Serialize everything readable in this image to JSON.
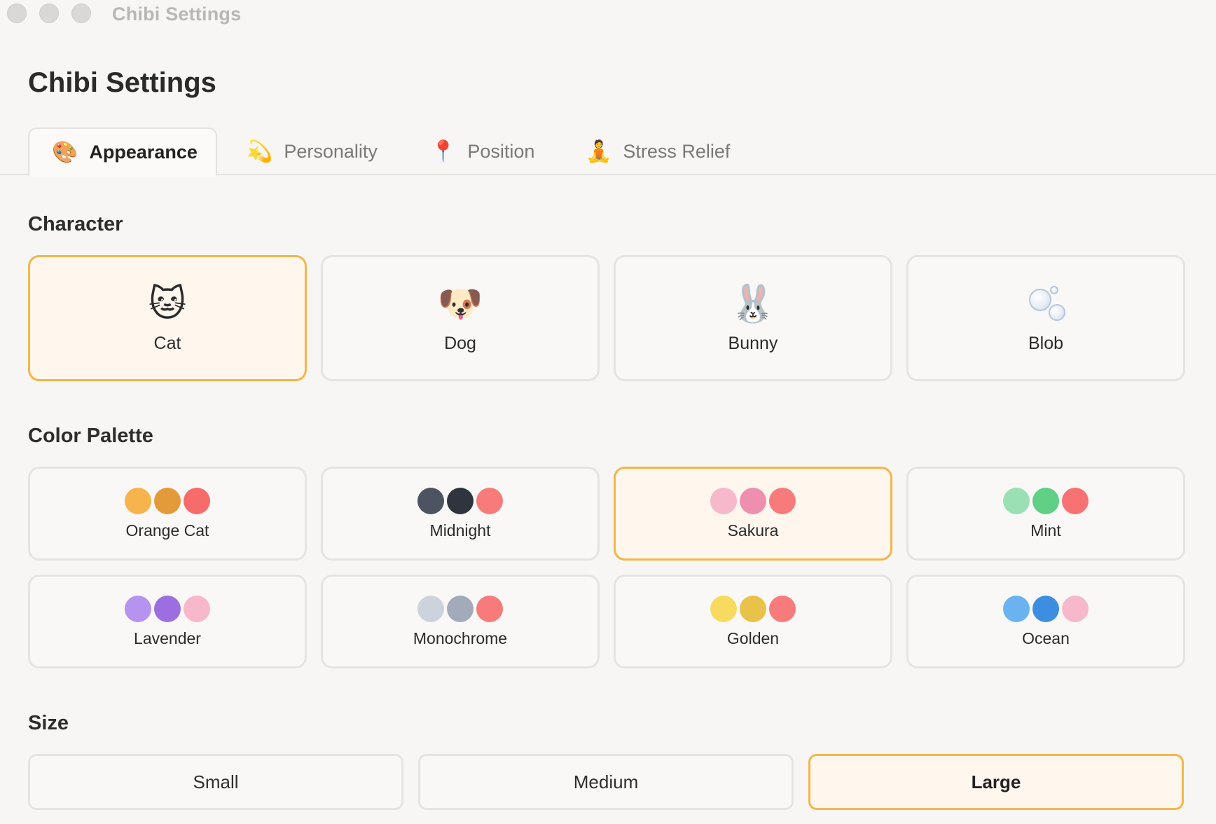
{
  "window": {
    "title": "Chibi Settings"
  },
  "page": {
    "title": "Chibi Settings"
  },
  "tabs": [
    {
      "label": "Appearance",
      "icon": "palette-icon",
      "active": true
    },
    {
      "label": "Personality",
      "icon": "comet-icon",
      "active": false
    },
    {
      "label": "Position",
      "icon": "pin-icon",
      "active": false
    },
    {
      "label": "Stress Relief",
      "icon": "meditation-icon",
      "active": false
    }
  ],
  "character": {
    "title": "Character",
    "options": [
      {
        "label": "Cat",
        "emoji": "🐱",
        "icon": "cat-icon",
        "selected": true
      },
      {
        "label": "Dog",
        "emoji": "🐶",
        "icon": "dog-icon",
        "selected": false
      },
      {
        "label": "Bunny",
        "emoji": "🐰",
        "icon": "bunny-icon",
        "selected": false
      },
      {
        "label": "Blob",
        "emoji": "",
        "icon": "bubbles-icon",
        "selected": false
      }
    ]
  },
  "palette": {
    "title": "Color Palette",
    "options": [
      {
        "label": "Orange Cat",
        "colors": [
          "#f7b44d",
          "#e39a3b",
          "#f76b6b"
        ],
        "selected": false
      },
      {
        "label": "Midnight",
        "colors": [
          "#4c5462",
          "#2f353e",
          "#f77b7b"
        ],
        "selected": false
      },
      {
        "label": "Sakura",
        "colors": [
          "#f7b8cc",
          "#ee8fb0",
          "#f77b7b"
        ],
        "selected": true
      },
      {
        "label": "Mint",
        "colors": [
          "#9be0b4",
          "#5fd086",
          "#f77272"
        ],
        "selected": false
      },
      {
        "label": "Lavender",
        "colors": [
          "#b593ef",
          "#9c6fe1",
          "#f7b8cc"
        ],
        "selected": false
      },
      {
        "label": "Monochrome",
        "colors": [
          "#ccd3dd",
          "#a2abba",
          "#f77b7b"
        ],
        "selected": false
      },
      {
        "label": "Golden",
        "colors": [
          "#f6db5e",
          "#e9c24a",
          "#f77b7b"
        ],
        "selected": false
      },
      {
        "label": "Ocean",
        "colors": [
          "#6bb2f1",
          "#3d8ee0",
          "#f7b8cc"
        ],
        "selected": false
      }
    ]
  },
  "size": {
    "title": "Size",
    "options": [
      {
        "label": "Small",
        "selected": false
      },
      {
        "label": "Medium",
        "selected": false
      },
      {
        "label": "Large",
        "selected": true
      }
    ]
  },
  "colors": {
    "accent": "#f4b649",
    "selected_bg": "#fff6ee",
    "card_border": "#e6e4e1"
  }
}
